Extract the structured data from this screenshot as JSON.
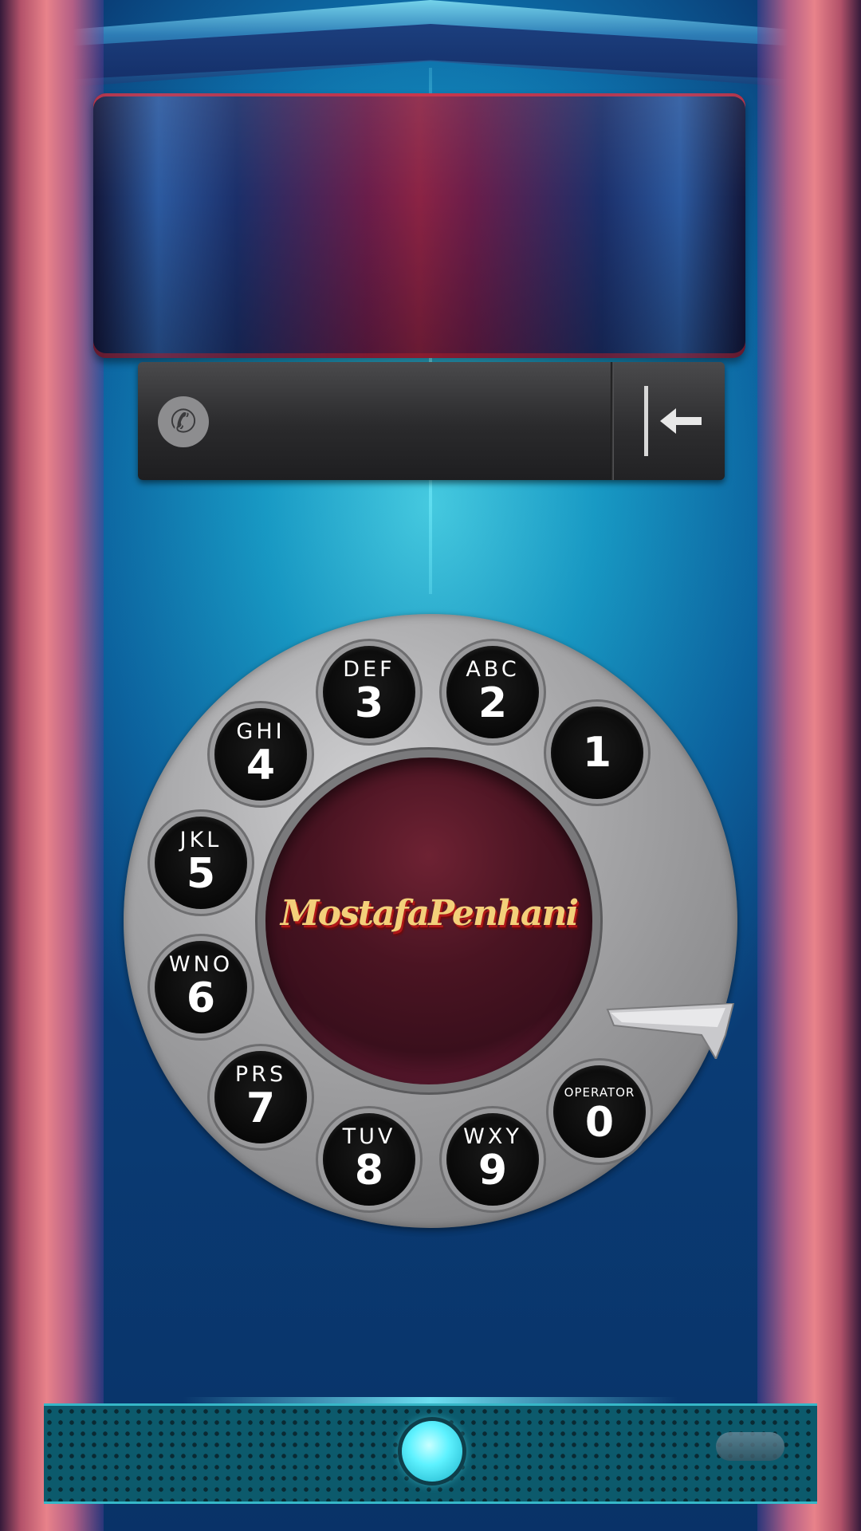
{
  "dialer": {
    "number_value": "",
    "call_icon": "phone-icon",
    "backspace_icon": "backspace-arrow-icon"
  },
  "dial": {
    "brand": "MostafaPenhani",
    "holes": [
      {
        "digit": "1",
        "letters": ""
      },
      {
        "digit": "2",
        "letters": "ABC"
      },
      {
        "digit": "3",
        "letters": "DEF"
      },
      {
        "digit": "4",
        "letters": "GHI"
      },
      {
        "digit": "5",
        "letters": "JKL"
      },
      {
        "digit": "6",
        "letters": "WNO"
      },
      {
        "digit": "7",
        "letters": "PRS"
      },
      {
        "digit": "8",
        "letters": "TUV"
      },
      {
        "digit": "9",
        "letters": "WXY"
      },
      {
        "digit": "0",
        "letters": "OPERATOR"
      }
    ]
  },
  "nav": {
    "home_icon": "home-button-icon"
  },
  "colors": {
    "background": "#1aa8d0",
    "pillar": "#e8828a",
    "dial_metal": "#a6a6a8",
    "center_plate": "#4a1422",
    "logo_gold": "#f3d07a",
    "home_glow": "#5ef2ff"
  }
}
